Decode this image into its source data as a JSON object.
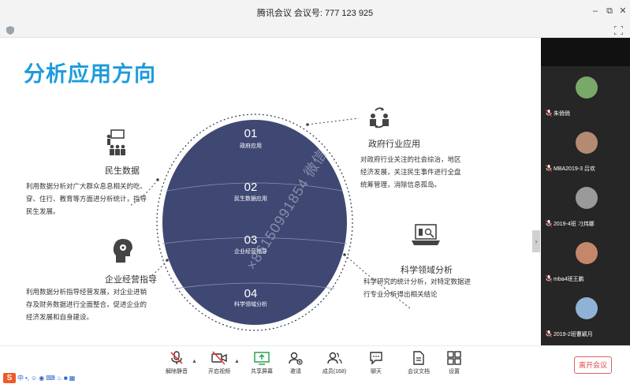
{
  "window": {
    "title": "腾讯会议 会议号: 777 123 925"
  },
  "slide": {
    "title": "分析应用方向",
    "watermark": "×86150991854 微信",
    "segments": [
      {
        "num": "01",
        "label": "政府应用"
      },
      {
        "num": "02",
        "label": "民生数据应用"
      },
      {
        "num": "03",
        "label": "企业经营指导"
      },
      {
        "num": "04",
        "label": "科学领域分析"
      }
    ],
    "sections": {
      "minsheng": {
        "title": "民生数据",
        "lines": [
          "利用数据分析对广大群众息息相关的吃、",
          "穿、住行、教育等方面进分析统计，指导",
          "民生发展。"
        ]
      },
      "qiye": {
        "title": "企业经营指导",
        "lines": [
          "利用数据分析指导经营发展，对企业进销",
          "存及财务数据进行全面整合，促进企业的",
          "经济发展和自身建设。"
        ]
      },
      "zhengfu": {
        "title": "政府行业应用",
        "lines": [
          "对政府行业关注的社会综治，地区",
          "经济发展，关注民生事件进行全盘",
          "统筹管理，消除信息孤岛。"
        ]
      },
      "kexue": {
        "title": "科学领域分析",
        "lines": [
          "科学研究的统计分析，对特定数据进",
          "行专业分析得出相关结论"
        ]
      }
    }
  },
  "participants": [
    {
      "name": "朱俏俏",
      "color": "#7aa86a"
    },
    {
      "name": "MBA2019-3 吕欢",
      "color": "#b58a73"
    },
    {
      "name": "2019-4班 刁炜娜",
      "color": "#9a9a9a"
    },
    {
      "name": "mba4班王鹏",
      "color": "#c4876a"
    },
    {
      "name": "2019-2班曹颖月",
      "color": "#8fb3d6"
    }
  ],
  "toolbar": {
    "items": [
      "解除静音",
      "开启视频",
      "共享屏幕",
      "邀请",
      "成员(168)",
      "聊天",
      "会议文档",
      "设置"
    ],
    "leave": "离开会议"
  },
  "ime": {
    "logo": "S",
    "lang": "中"
  }
}
